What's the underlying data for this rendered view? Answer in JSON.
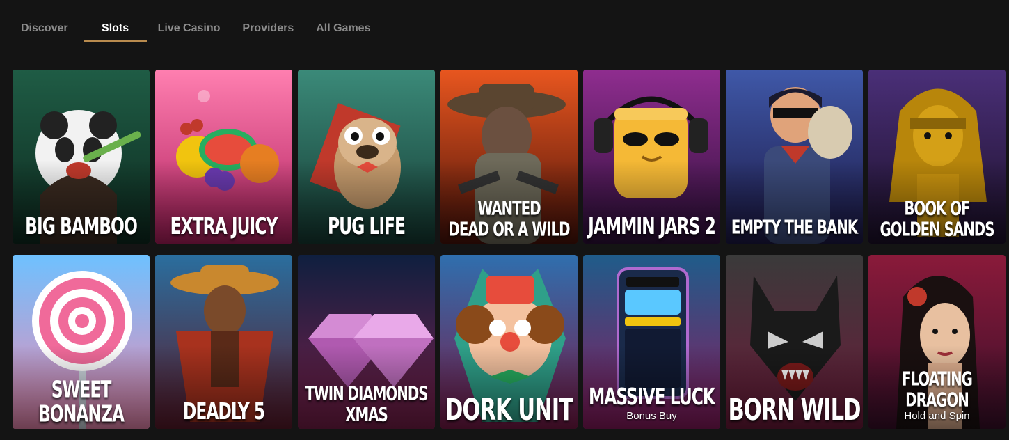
{
  "tabs": [
    {
      "label": "Discover",
      "active": false
    },
    {
      "label": "Slots",
      "active": true
    },
    {
      "label": "Live Casino",
      "active": false
    },
    {
      "label": "Providers",
      "active": false
    },
    {
      "label": "All Games",
      "active": false
    }
  ],
  "accent_color": "#b98b4e",
  "games": [
    {
      "title": "BIG BAMBOO",
      "subtitle": "",
      "bg": [
        "#1f5c45",
        "#0d2a1f"
      ],
      "icon": "panda-icon"
    },
    {
      "title": "EXTRA JUICY",
      "subtitle": "",
      "bg": [
        "#ff7fb0",
        "#b01f5e"
      ],
      "icon": "fruits-icon"
    },
    {
      "title": "PUG LIFE",
      "subtitle": "",
      "bg": [
        "#3b8a79",
        "#153b33"
      ],
      "icon": "pug-icon"
    },
    {
      "title": "WANTED\nDEAD OR A WILD",
      "subtitle": "",
      "bg": [
        "#e8561f",
        "#4a1209"
      ],
      "icon": "cowboy-icon"
    },
    {
      "title": "JAMMIN JARS 2",
      "subtitle": "",
      "bg": [
        "#8f2d8f",
        "#2e0f3a"
      ],
      "icon": "jar-icon"
    },
    {
      "title": "EMPTY THE BANK",
      "subtitle": "",
      "bg": [
        "#3f58a8",
        "#1c1845"
      ],
      "icon": "robber-icon"
    },
    {
      "title": "BOOK OF\nGOLDEN SANDS",
      "subtitle": "",
      "bg": [
        "#4a2f78",
        "#1c1029"
      ],
      "icon": "pharaoh-icon"
    },
    {
      "title": "SWEET BONANZA",
      "subtitle": "",
      "bg": [
        "#6ec1ff",
        "#f08ab2"
      ],
      "icon": "lollipop-icon"
    },
    {
      "title": "DEADLY 5",
      "subtitle": "",
      "bg": [
        "#2a6e9e",
        "#5b1a2a"
      ],
      "icon": "bandit-icon"
    },
    {
      "title": "TWIN DIAMONDS\nXMAS",
      "subtitle": "",
      "bg": [
        "#0f1f3f",
        "#7a1f4a"
      ],
      "icon": "diamond-icon"
    },
    {
      "title": "DORK UNIT",
      "subtitle": "",
      "bg": [
        "#2f6fae",
        "#7a1a48"
      ],
      "icon": "clown-icon"
    },
    {
      "title": "MASSIVE LUCK",
      "subtitle": "Bonus Buy",
      "bg": [
        "#1f5c8a",
        "#8a1a5e"
      ],
      "icon": "slot-machine-icon"
    },
    {
      "title": "BORN WILD",
      "subtitle": "",
      "bg": [
        "#3a3a3a",
        "#6e1a3a"
      ],
      "icon": "wolf-icon"
    },
    {
      "title": "FLOATING DRAGON",
      "subtitle": "Hold and Spin",
      "bg": [
        "#8a1a3a",
        "#3a0f2a"
      ],
      "icon": "dragon-lady-icon"
    }
  ]
}
